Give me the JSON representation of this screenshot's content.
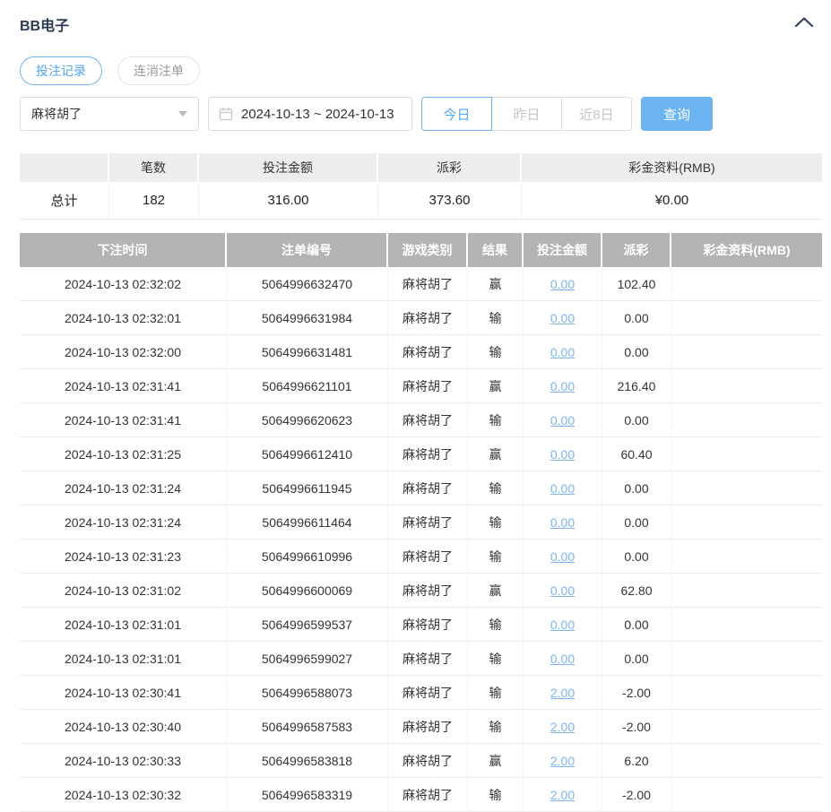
{
  "page": {
    "title": "BB电子"
  },
  "tabs": [
    {
      "label": "投注记录",
      "active": true
    },
    {
      "label": "连消注单",
      "active": false
    }
  ],
  "filters": {
    "game_select": {
      "value": "麻将胡了"
    },
    "date_range": "2024-10-13 ~ 2024-10-13",
    "quick_buttons": [
      {
        "label": "今日",
        "active": true
      },
      {
        "label": "昨日",
        "active": false
      },
      {
        "label": "近8日",
        "active": false
      }
    ],
    "query_label": "查询"
  },
  "summary": {
    "headers": [
      "",
      "笔数",
      "投注金额",
      "派彩",
      "彩金资料(RMB)"
    ],
    "total": {
      "label": "总计",
      "count": "182",
      "bet_amount": "316.00",
      "payout": "373.60",
      "jackpot": "¥0.00"
    }
  },
  "records": {
    "headers": [
      "下注时间",
      "注单编号",
      "游戏类别",
      "结果",
      "投注金额",
      "派彩",
      "彩金资料(RMB)"
    ],
    "rows": [
      {
        "time": "2024-10-13 02:32:02",
        "id": "5064996632470",
        "game": "麻将胡了",
        "result": "赢",
        "bet": "0.00",
        "payout": "102.40",
        "jackpot": ""
      },
      {
        "time": "2024-10-13 02:32:01",
        "id": "5064996631984",
        "game": "麻将胡了",
        "result": "输",
        "bet": "0.00",
        "payout": "0.00",
        "jackpot": ""
      },
      {
        "time": "2024-10-13 02:32:00",
        "id": "5064996631481",
        "game": "麻将胡了",
        "result": "输",
        "bet": "0.00",
        "payout": "0.00",
        "jackpot": ""
      },
      {
        "time": "2024-10-13 02:31:41",
        "id": "5064996621101",
        "game": "麻将胡了",
        "result": "赢",
        "bet": "0.00",
        "payout": "216.40",
        "jackpot": ""
      },
      {
        "time": "2024-10-13 02:31:41",
        "id": "5064996620623",
        "game": "麻将胡了",
        "result": "输",
        "bet": "0.00",
        "payout": "0.00",
        "jackpot": ""
      },
      {
        "time": "2024-10-13 02:31:25",
        "id": "5064996612410",
        "game": "麻将胡了",
        "result": "赢",
        "bet": "0.00",
        "payout": "60.40",
        "jackpot": ""
      },
      {
        "time": "2024-10-13 02:31:24",
        "id": "5064996611945",
        "game": "麻将胡了",
        "result": "输",
        "bet": "0.00",
        "payout": "0.00",
        "jackpot": ""
      },
      {
        "time": "2024-10-13 02:31:24",
        "id": "5064996611464",
        "game": "麻将胡了",
        "result": "输",
        "bet": "0.00",
        "payout": "0.00",
        "jackpot": ""
      },
      {
        "time": "2024-10-13 02:31:23",
        "id": "5064996610996",
        "game": "麻将胡了",
        "result": "输",
        "bet": "0.00",
        "payout": "0.00",
        "jackpot": ""
      },
      {
        "time": "2024-10-13 02:31:02",
        "id": "5064996600069",
        "game": "麻将胡了",
        "result": "赢",
        "bet": "0.00",
        "payout": "62.80",
        "jackpot": ""
      },
      {
        "time": "2024-10-13 02:31:01",
        "id": "5064996599537",
        "game": "麻将胡了",
        "result": "输",
        "bet": "0.00",
        "payout": "0.00",
        "jackpot": ""
      },
      {
        "time": "2024-10-13 02:31:01",
        "id": "5064996599027",
        "game": "麻将胡了",
        "result": "输",
        "bet": "0.00",
        "payout": "0.00",
        "jackpot": ""
      },
      {
        "time": "2024-10-13 02:30:41",
        "id": "5064996588073",
        "game": "麻将胡了",
        "result": "输",
        "bet": "2.00",
        "payout": "-2.00",
        "jackpot": ""
      },
      {
        "time": "2024-10-13 02:30:40",
        "id": "5064996587583",
        "game": "麻将胡了",
        "result": "输",
        "bet": "2.00",
        "payout": "-2.00",
        "jackpot": ""
      },
      {
        "time": "2024-10-13 02:30:33",
        "id": "5064996583818",
        "game": "麻将胡了",
        "result": "赢",
        "bet": "2.00",
        "payout": "6.20",
        "jackpot": ""
      },
      {
        "time": "2024-10-13 02:30:32",
        "id": "5064996583319",
        "game": "麻将胡了",
        "result": "输",
        "bet": "2.00",
        "payout": "-2.00",
        "jackpot": ""
      }
    ]
  },
  "colors": {
    "accent_blue": "#6db4f3",
    "link_blue": "#7ab5ee",
    "negative_red": "#e4595d",
    "table_header_gray": "#b3b3b3",
    "summary_header_gray": "#ededed",
    "title_navy": "#2b3a50"
  }
}
